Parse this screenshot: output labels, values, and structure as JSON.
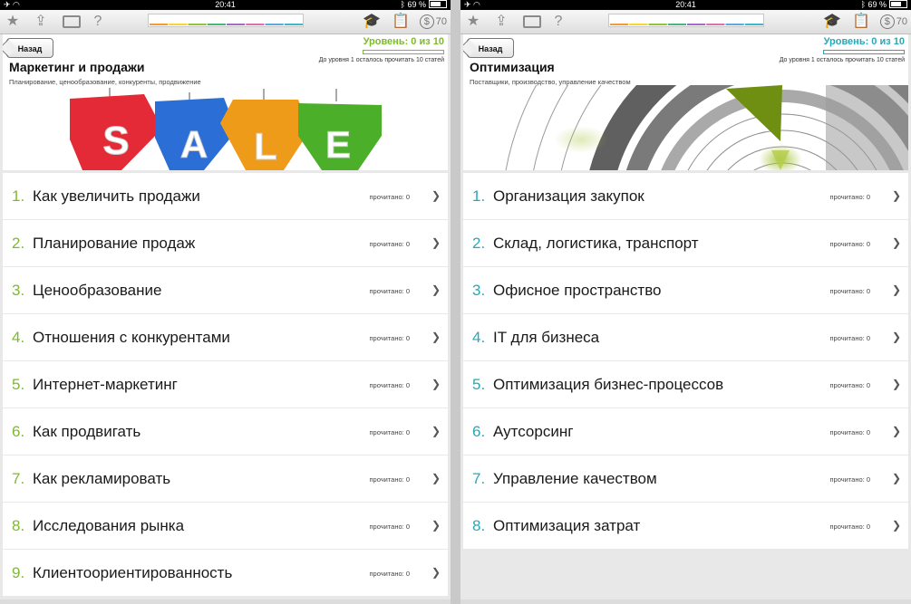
{
  "statusbar": {
    "time": "20:41",
    "battery": "69 %"
  },
  "toolbar": {
    "icons": [
      "star-icon",
      "share-icon",
      "keyboard-icon",
      "help-icon",
      "graduation-cap-icon",
      "clipboard-icon",
      "dollar-coin-icon"
    ],
    "help_glyph": "?",
    "coin_symbol": "$",
    "coins": "70",
    "color_segments": [
      "#f29b38",
      "#f5d632",
      "#8fc43f",
      "#45b97c",
      "#a36bc6",
      "#e06fae",
      "#5da9e3",
      "#41b8c7"
    ]
  },
  "panels": [
    {
      "back_label": "Назад",
      "level_text": "Уровень: 0 из 10",
      "level_note": "До уровня 1 осталось прочитать 10 статей",
      "level_progress": 0,
      "title": "Маркетинг и продажи",
      "subtitle": "Планирование, ценообразование, конкуренты, продвижение",
      "accent": "#7dba2f",
      "banner_letters": [
        "S",
        "A",
        "L",
        "E"
      ],
      "banner_colors": [
        "#e52a37",
        "#2b6fd6",
        "#ef9b1a",
        "#4caf2a"
      ],
      "items": [
        {
          "num": "1.",
          "title": "Как увеличить продажи",
          "read": "прочитано: 0"
        },
        {
          "num": "2.",
          "title": "Планирование продаж",
          "read": "прочитано: 0"
        },
        {
          "num": "3.",
          "title": "Ценообразование",
          "read": "прочитано: 0"
        },
        {
          "num": "4.",
          "title": "Отношения с конкурентами",
          "read": "прочитано: 0"
        },
        {
          "num": "5.",
          "title": "Интернет-маркетинг",
          "read": "прочитано: 0"
        },
        {
          "num": "6.",
          "title": "Как продвигать",
          "read": "прочитано: 0"
        },
        {
          "num": "7.",
          "title": "Как рекламировать",
          "read": "прочитано: 0"
        },
        {
          "num": "8.",
          "title": "Исследования рынка",
          "read": "прочитано: 0"
        },
        {
          "num": "9.",
          "title": "Клиентоориентированность",
          "read": "прочитано: 0"
        }
      ]
    },
    {
      "back_label": "Назад",
      "level_text": "Уровень: 0 из 10",
      "level_note": "До уровня 1 осталось прочитать 10 статей",
      "level_progress": 0,
      "title": "Оптимизация",
      "subtitle": "Поставщики, производство, управление качеством",
      "accent": "#2aa7b7",
      "items": [
        {
          "num": "1.",
          "title": "Организация закупок",
          "read": "прочитано: 0"
        },
        {
          "num": "2.",
          "title": "Склад, логистика, транспорт",
          "read": "прочитано: 0"
        },
        {
          "num": "3.",
          "title": "Офисное пространство",
          "read": "прочитано: 0"
        },
        {
          "num": "4.",
          "title": "IT для бизнеса",
          "read": "прочитано: 0"
        },
        {
          "num": "5.",
          "title": "Оптимизация бизнес-процессов",
          "read": "прочитано: 0"
        },
        {
          "num": "6.",
          "title": "Аутсорсинг",
          "read": "прочитано: 0"
        },
        {
          "num": "7.",
          "title": "Управление качеством",
          "read": "прочитано: 0"
        },
        {
          "num": "8.",
          "title": "Оптимизация затрат",
          "read": "прочитано: 0"
        }
      ]
    }
  ]
}
